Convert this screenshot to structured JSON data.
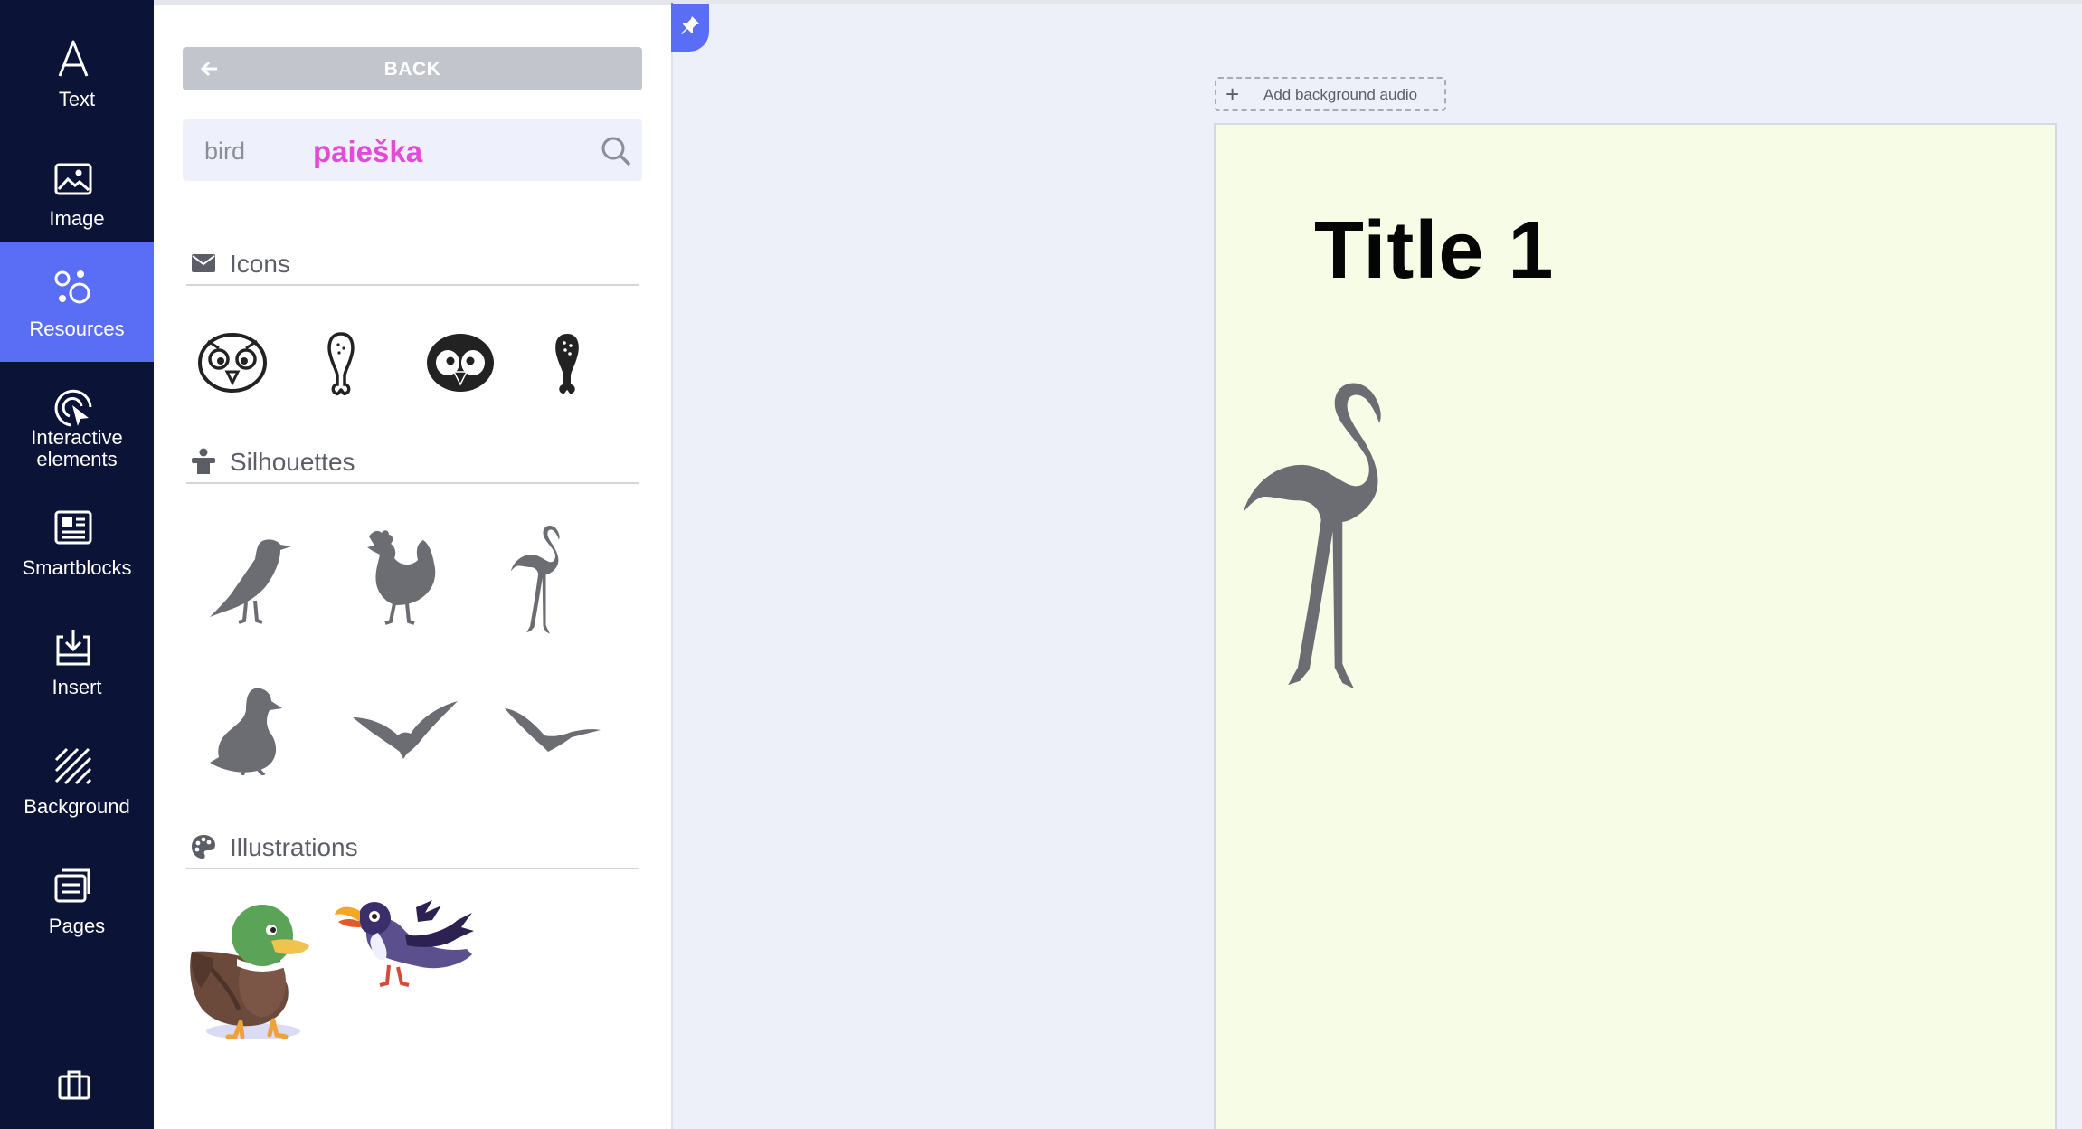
{
  "rail": {
    "items": [
      {
        "label": "Text",
        "icon": "text-icon"
      },
      {
        "label": "Image",
        "icon": "image-icon"
      },
      {
        "label": "Resources",
        "icon": "resources-icon",
        "active": true
      },
      {
        "label": "Interactive elements",
        "icon": "interactive-elements-icon"
      },
      {
        "label": "Smartblocks",
        "icon": "smartblocks-icon"
      },
      {
        "label": "Insert",
        "icon": "insert-icon"
      },
      {
        "label": "Background",
        "icon": "background-icon"
      },
      {
        "label": "Pages",
        "icon": "pages-icon"
      }
    ],
    "bottom_icon": "briefcase-icon"
  },
  "panel": {
    "back_label": "BACK",
    "search": {
      "value": "bird",
      "brand": "paieška"
    },
    "sections": {
      "icons": {
        "title": "Icons",
        "icon": "envelope-icon",
        "items": [
          "owl-outline-icon",
          "drumstick-outline-icon",
          "penguin-icon",
          "drumstick-icon"
        ]
      },
      "silhouettes": {
        "title": "Silhouettes",
        "icon": "person-icon",
        "items": [
          "sandpiper-silhouette",
          "rooster-silhouette",
          "flamingo-silhouette",
          "duck-silhouette",
          "flying-bird-silhouette",
          "gull-silhouette"
        ]
      },
      "illustrations": {
        "title": "Illustrations",
        "icon": "palette-icon",
        "items": [
          "mallard-duck-illustration",
          "toucan-illustration"
        ]
      }
    }
  },
  "canvas": {
    "audio_label": "Add background audio",
    "page_title": "Title 1",
    "page_image": "flamingo-silhouette"
  },
  "colors": {
    "rail_bg": "#0b1437",
    "accent": "#5a6df5",
    "brand_pink": "#e44ad8",
    "page_bg": "#f7fce6",
    "silhouette": "#6b6d72"
  }
}
